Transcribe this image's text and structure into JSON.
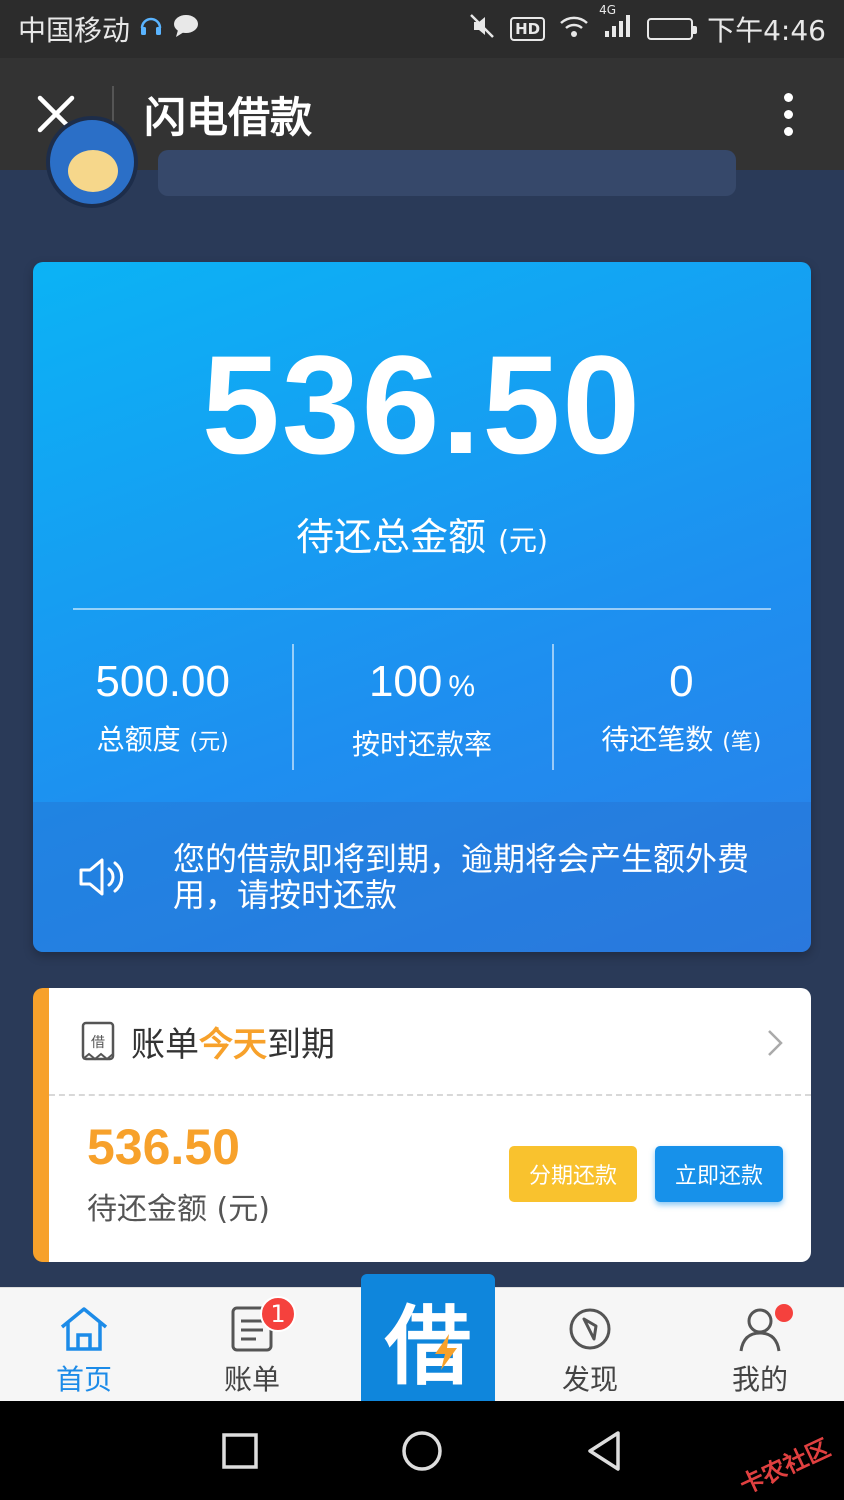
{
  "statusbar": {
    "carrier": "中国移动",
    "hd": "HD",
    "network": "4G",
    "time": "下午4:46"
  },
  "titlebar": {
    "title": "闪电借款"
  },
  "summary": {
    "amount": "536.50",
    "label": "待还总金额",
    "unit": "(元)",
    "stats": [
      {
        "value": "500.00",
        "suffix": "",
        "label": "总额度",
        "unit": "(元)"
      },
      {
        "value": "100",
        "suffix": "%",
        "label": "按时还款率",
        "unit": ""
      },
      {
        "value": "0",
        "suffix": "",
        "label": "待还笔数",
        "unit": "(笔)"
      }
    ],
    "notice": "您的借款即将到期，逾期将会产生额外费用，请按时还款"
  },
  "bill": {
    "title_prefix": "账单",
    "title_highlight": "今天",
    "title_suffix": "到期",
    "amount": "536.50",
    "amount_label": "待还金额 (元)",
    "installment_button": "分期还款",
    "pay_button": "立即还款"
  },
  "tabbar": {
    "home": "首页",
    "bills": "账单",
    "bills_badge": "1",
    "center_glyph": "借",
    "discover": "发现",
    "mine": "我的"
  },
  "colors": {
    "accent_blue": "#1791ea",
    "accent_orange": "#f7a12b",
    "button_yellow": "#f9c22e",
    "badge_red": "#f5413d"
  },
  "watermark": "卡农社区"
}
